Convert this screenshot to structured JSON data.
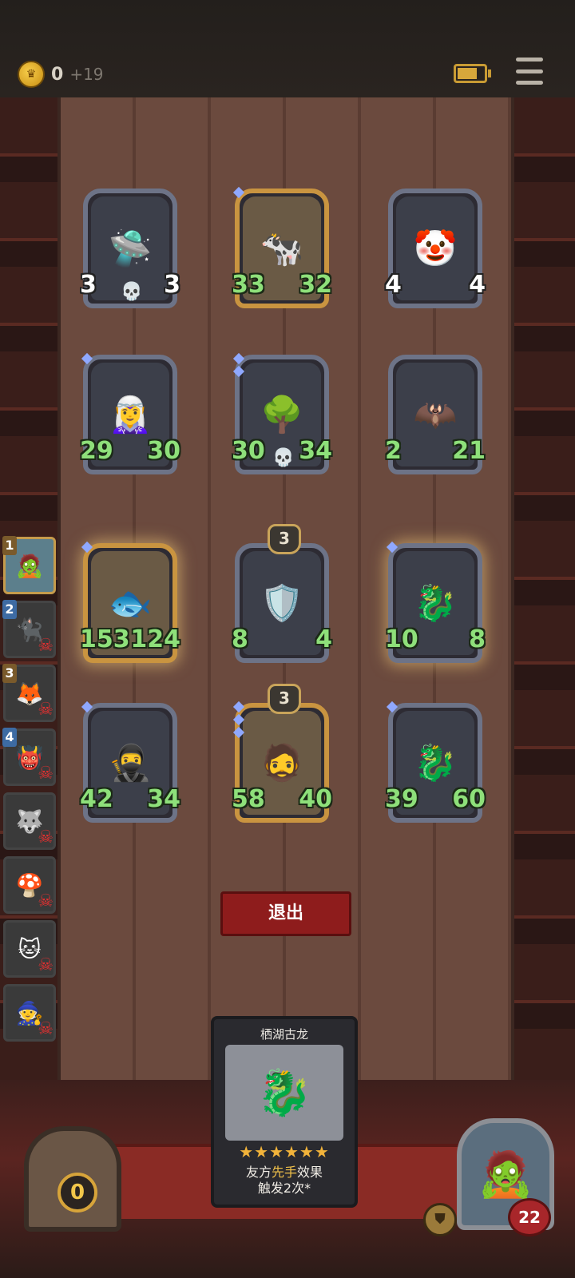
{
  "header": {
    "gold_value": "0",
    "gold_income": "+19",
    "coin_icon": "crown-coin-icon",
    "battery_icon": "battery-icon",
    "menu_icon": "hamburger-menu-icon"
  },
  "board": {
    "cards": [
      {
        "id": "c1",
        "art": "🛸",
        "attack": "3",
        "health": "3",
        "attack_color": "white",
        "health_color": "white",
        "frame": "silver",
        "skull": true
      },
      {
        "id": "c2",
        "art": "🐄",
        "attack": "33",
        "health": "32",
        "attack_color": "green",
        "health_color": "green",
        "frame": "gold",
        "gems": 1
      },
      {
        "id": "c3",
        "art": "🤡",
        "attack": "4",
        "health": "4",
        "attack_color": "white",
        "health_color": "white",
        "frame": "silver"
      },
      {
        "id": "c4",
        "art": "🧝‍♀️",
        "attack": "29",
        "health": "30",
        "attack_color": "green",
        "health_color": "green",
        "frame": "silver",
        "gems": 1
      },
      {
        "id": "c5",
        "art": "🌳",
        "attack": "30",
        "health": "34",
        "attack_color": "green",
        "health_color": "green",
        "frame": "silver",
        "gems": 2,
        "skull": true
      },
      {
        "id": "c6",
        "art": "🦇",
        "attack": "2",
        "health": "21",
        "attack_color": "green",
        "health_color": "green",
        "frame": "silver"
      },
      {
        "id": "c7",
        "art": "🐟",
        "attack": "153",
        "health": "124",
        "attack_color": "green",
        "health_color": "green",
        "frame": "gold",
        "gems": 1,
        "shine": true
      },
      {
        "id": "c8",
        "art": "🛡️",
        "attack": "8",
        "health": "4",
        "attack_color": "green",
        "health_color": "green",
        "frame": "silver",
        "tier": "3"
      },
      {
        "id": "c9",
        "art": "🐉",
        "attack": "10",
        "health": "8",
        "attack_color": "green",
        "health_color": "green",
        "frame": "silver",
        "gems": 1,
        "shine": true
      },
      {
        "id": "c10",
        "art": "🥷",
        "attack": "42",
        "health": "34",
        "attack_color": "green",
        "health_color": "green",
        "frame": "silver",
        "gems": 1
      },
      {
        "id": "c11",
        "art": "🧔",
        "attack": "58",
        "health": "40",
        "attack_color": "green",
        "health_color": "green",
        "frame": "gold",
        "gems": 3,
        "tier": "3"
      },
      {
        "id": "c12",
        "art": "🐉",
        "attack": "39",
        "health": "60",
        "attack_color": "green",
        "health_color": "green",
        "frame": "silver",
        "gems": 1
      }
    ]
  },
  "warband": [
    {
      "num": "1",
      "art": "🧟",
      "active": true
    },
    {
      "num": "2",
      "art": "🐈‍⬛",
      "dead": true,
      "blue": true
    },
    {
      "num": "3",
      "art": "🦊",
      "dead": true
    },
    {
      "num": "4",
      "art": "👹",
      "dead": true,
      "blue": true
    },
    {
      "num": "",
      "art": "🐺",
      "dead": true
    },
    {
      "num": "",
      "art": "🍄",
      "dead": true
    },
    {
      "num": "",
      "art": "🐱",
      "dead": true
    },
    {
      "num": "",
      "art": "🧙",
      "dead": true
    }
  ],
  "exit_button": {
    "label": "退出"
  },
  "spell_card": {
    "title": "栖湖古龙",
    "art": "🐉",
    "stars": "★★★★★★",
    "desc_line1_a": "友方",
    "desc_line1_hl": "先手",
    "desc_line1_b": "效果",
    "desc_line2": "触发2次*"
  },
  "vault": {
    "value": "0"
  },
  "hero": {
    "art": "🧟",
    "health": "22",
    "shield_icon": "armor-shield-icon"
  }
}
